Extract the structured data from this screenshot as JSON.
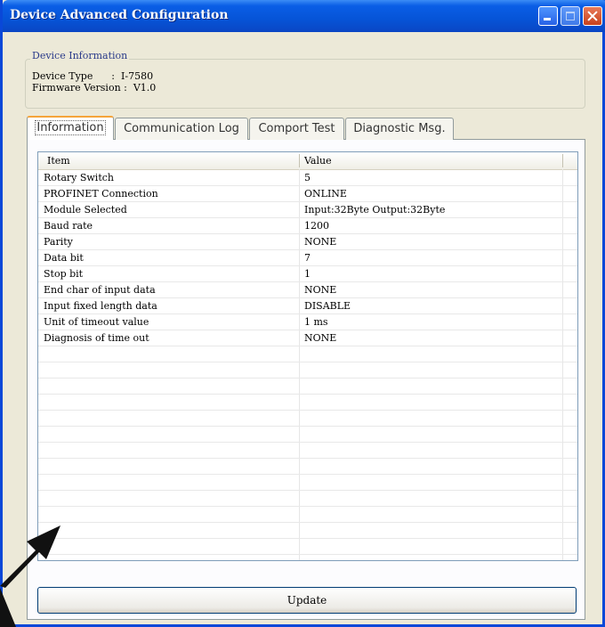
{
  "window": {
    "title": "Device Advanced Configuration"
  },
  "device_info": {
    "legend": "Device Information",
    "lines": [
      "Device Type      :  I-7580",
      "Firmware Version :  V1.0"
    ]
  },
  "tabs": [
    "Information",
    "Communication Log",
    "Comport Test",
    "Diagnostic Msg."
  ],
  "table": {
    "columns": [
      "Item",
      "Value"
    ],
    "rows": [
      [
        "Rotary Switch",
        "5"
      ],
      [
        "PROFINET Connection",
        "ONLINE"
      ],
      [
        "Module Selected",
        "Input:32Byte Output:32Byte"
      ],
      [
        "Baud rate",
        "1200"
      ],
      [
        "Parity",
        "NONE"
      ],
      [
        "Data bit",
        "7"
      ],
      [
        "Stop bit",
        "1"
      ],
      [
        "End char of input data",
        "NONE"
      ],
      [
        "Input fixed length data",
        "DISABLE"
      ],
      [
        "Unit of timeout value",
        "1 ms"
      ],
      [
        "Diagnosis of time out",
        "NONE"
      ]
    ]
  },
  "buttons": {
    "update": "Update"
  },
  "icons": {
    "minimize": "minimize-icon",
    "maximize": "maximize-icon",
    "close": "close-icon",
    "annotation": "arrow-annotation-icon"
  },
  "colors": {
    "titlebar": "#0a5ee6",
    "active_tab_accent": "#f5a43a",
    "window_bg": "#ece9d8"
  }
}
